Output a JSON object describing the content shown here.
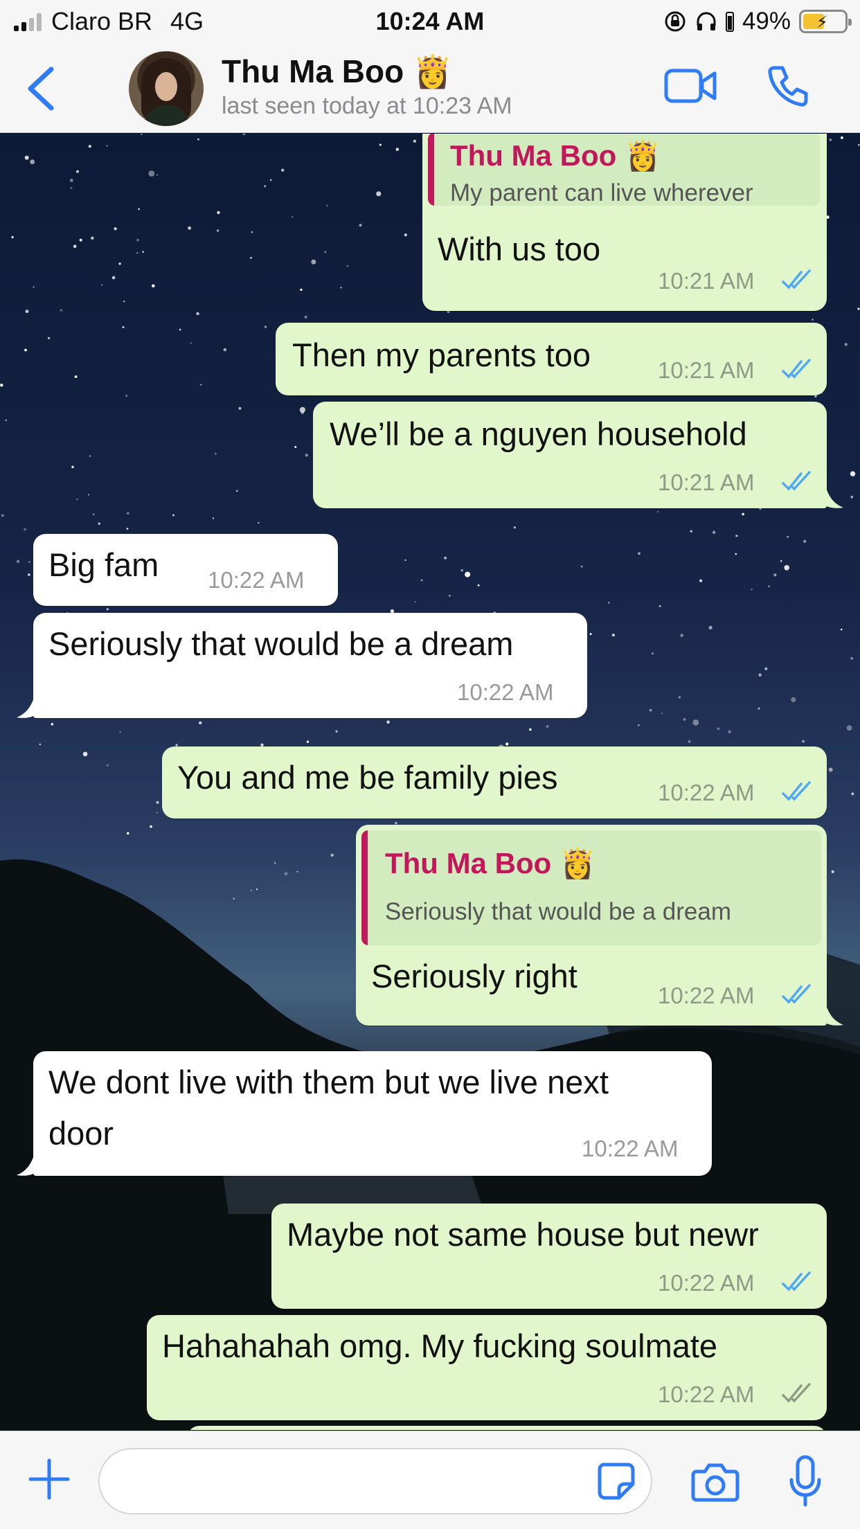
{
  "status_bar": {
    "carrier": "Claro BR",
    "network": "4G",
    "time": "10:24 AM",
    "battery": "49%"
  },
  "header": {
    "contact_name": "Thu Ma Boo 👸",
    "last_seen": "last seen today at 10:23 AM"
  },
  "messages": [
    {
      "dir": "out",
      "reply_to": {
        "name": "Thu Ma Boo 👸",
        "text": "My parent can live wherever"
      },
      "text": "With us too",
      "time": "10:21 AM",
      "status": "read"
    },
    {
      "dir": "out",
      "text": "Then my parents too",
      "time": "10:21 AM",
      "status": "read"
    },
    {
      "dir": "out",
      "text": "We’ll be a nguyen household",
      "time": "10:21 AM",
      "status": "read"
    },
    {
      "dir": "in",
      "text": "Big fam",
      "time": "10:22 AM"
    },
    {
      "dir": "in",
      "text": "Seriously that would be a dream",
      "time": "10:22 AM"
    },
    {
      "dir": "out",
      "text": "You and me be family pies",
      "time": "10:22 AM",
      "status": "read"
    },
    {
      "dir": "out",
      "reply_to": {
        "name": "Thu Ma Boo 👸",
        "text": "Seriously that would be a dream"
      },
      "text": "Seriously right",
      "time": "10:22 AM",
      "status": "read"
    },
    {
      "dir": "in",
      "text_line1": "We dont live with them but we live next",
      "text_line2": "door",
      "time": "10:22 AM"
    },
    {
      "dir": "out",
      "text": "Maybe not same house but newr",
      "time": "10:22 AM",
      "status": "read"
    },
    {
      "dir": "out",
      "text": "Hahahahah omg. My fucking soulmate",
      "time": "10:22 AM",
      "status": "delivered"
    }
  ],
  "input": {
    "placeholder": ""
  },
  "colors": {
    "accent": "#2f7cf6",
    "outgoing_bubble": "#e1f7cb",
    "incoming_bubble": "#ffffff",
    "read_ticks": "#4fa8f5",
    "delivered_ticks": "#8e9a86",
    "reply_name": "#c2185b"
  },
  "icons": [
    "back-chevron-icon",
    "video-call-icon",
    "phone-call-icon",
    "plus-icon",
    "sticker-icon",
    "camera-icon",
    "microphone-icon",
    "double-check-icon"
  ]
}
